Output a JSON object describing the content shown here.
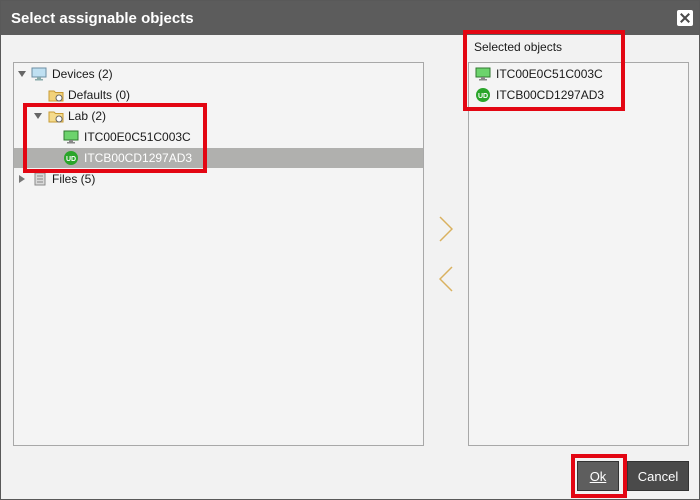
{
  "dialog": {
    "title": "Select assignable objects"
  },
  "left_tree": [
    {
      "label": "Devices (2)",
      "icon": "monitor-icon",
      "expander": "expanded"
    },
    {
      "label": "Defaults (0)",
      "icon": "folder-icon",
      "expander": "none"
    },
    {
      "label": "Lab (2)",
      "icon": "folder-open-icon",
      "expander": "expanded"
    },
    {
      "label": "ITC00E0C51C003C",
      "icon": "monitor-green-icon",
      "expander": "none"
    },
    {
      "label": "ITCB00CD1297AD3",
      "icon": "udc-icon",
      "expander": "none",
      "selected": true
    },
    {
      "label": "Files (5)",
      "icon": "files-icon",
      "expander": "collapsed"
    }
  ],
  "selected_objects": {
    "label": "Selected objects",
    "items": [
      {
        "label": "ITC00E0C51C003C",
        "icon": "monitor-green-icon"
      },
      {
        "label": "ITCB00CD1297AD3",
        "icon": "udc-icon"
      }
    ]
  },
  "buttons": {
    "ok": "Ok",
    "cancel": "Cancel"
  },
  "colors": {
    "highlight": "#e30613",
    "titlebar": "#5c5c5c",
    "selected_row": "#b0b0ae",
    "arrow": "#d9b15f"
  }
}
